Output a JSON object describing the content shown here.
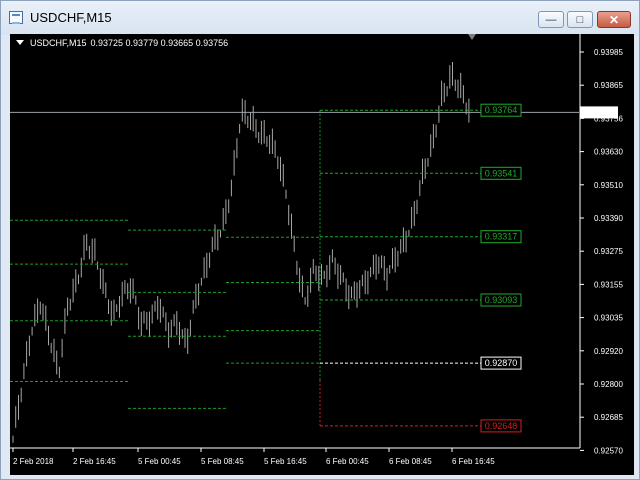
{
  "window": {
    "title": "USDCHF,M15",
    "controls": {
      "minimize_label": "—",
      "restore_label": "□",
      "close_label": "✕"
    }
  },
  "chart": {
    "symbol": "USDCHF,M15",
    "ohlc": "0.93725 0.93779 0.93665 0.93756",
    "background": "#000000",
    "price_axis": [
      "0.93985",
      "0.93865",
      "0.93756",
      "0.93630",
      "0.93510",
      "0.93390",
      "0.93275",
      "0.93155",
      "0.93035",
      "0.92920",
      "0.92800",
      "0.92685",
      "0.92570"
    ],
    "time_axis": [
      "2 Feb 2018",
      "2 Feb 16:45",
      "5 Feb 00:45",
      "5 Feb 08:45",
      "5 Feb 16:45",
      "6 Feb 00:45",
      "6 Feb 08:45",
      "6 Feb 16:45"
    ],
    "current_price": "0.93756",
    "level_tags": [
      {
        "label": "0.93764",
        "color": "#1eaa2c",
        "text_color": "#1eaa2c",
        "value": 0.93764
      },
      {
        "label": "0.93541",
        "color": "#1eaa2c",
        "text_color": "#1eaa2c",
        "value": 0.93541
      },
      {
        "label": "0.93317",
        "color": "#1eaa2c",
        "text_color": "#1eaa2c",
        "value": 0.93317
      },
      {
        "label": "0.93093",
        "color": "#1eaa2c",
        "text_color": "#1eaa2c",
        "value": 0.93093
      },
      {
        "label": "0.92870",
        "color": "#ffffff",
        "text_color": "#ffffff",
        "value": 0.9287
      },
      {
        "label": "0.92648",
        "color": "#d61f1f",
        "text_color": "#d61f1f",
        "value": 0.92648
      }
    ],
    "colors": {
      "bars": "#a7a7a7",
      "grid_green": "#1a9c2a",
      "axis": "#ffffff",
      "current_line": "#9aa3aa"
    }
  },
  "chart_data": {
    "type": "line",
    "title": "",
    "xlabel": "",
    "ylabel": "",
    "ylim": [
      0.9257,
      0.94005
    ],
    "x": [
      "2 Feb 2018",
      "",
      "",
      "",
      "",
      "2 Feb 16:45",
      "",
      "",
      "",
      "",
      "5 Feb 00:45",
      "",
      "",
      "",
      "",
      "5 Feb 08:45",
      "",
      "",
      "",
      "",
      "5 Feb 16:45",
      "",
      "",
      "",
      "",
      "6 Feb 00:45",
      "",
      "",
      "",
      "",
      "6 Feb 08:45",
      "",
      "",
      "",
      "",
      "6 Feb 16:45",
      "",
      "",
      "",
      "",
      ""
    ],
    "series": [
      {
        "name": "",
        "values": [
          0.926,
          0.9278,
          0.9298,
          0.9309,
          0.9296,
          0.9282,
          0.9307,
          0.9316,
          0.9329,
          0.9324,
          0.9313,
          0.9304,
          0.9311,
          0.9313,
          0.9301,
          0.9303,
          0.9308,
          0.9297,
          0.9301,
          0.9294,
          0.9309,
          0.9318,
          0.9329,
          0.9336,
          0.9349,
          0.9374,
          0.9373,
          0.9369,
          0.9366,
          0.9359,
          0.9346,
          0.9325,
          0.9308,
          0.9319,
          0.9316,
          0.9324,
          0.9317,
          0.9309,
          0.9313,
          0.9318,
          0.9323,
          0.9317,
          0.9324,
          0.9331,
          0.9339,
          0.9353,
          0.9364,
          0.9381,
          0.9388,
          0.9383,
          0.9376
        ]
      }
    ],
    "levels": [
      0.93764,
      0.93541,
      0.93317,
      0.93093,
      0.9287,
      0.92648
    ],
    "grid": false,
    "legend": "none"
  }
}
